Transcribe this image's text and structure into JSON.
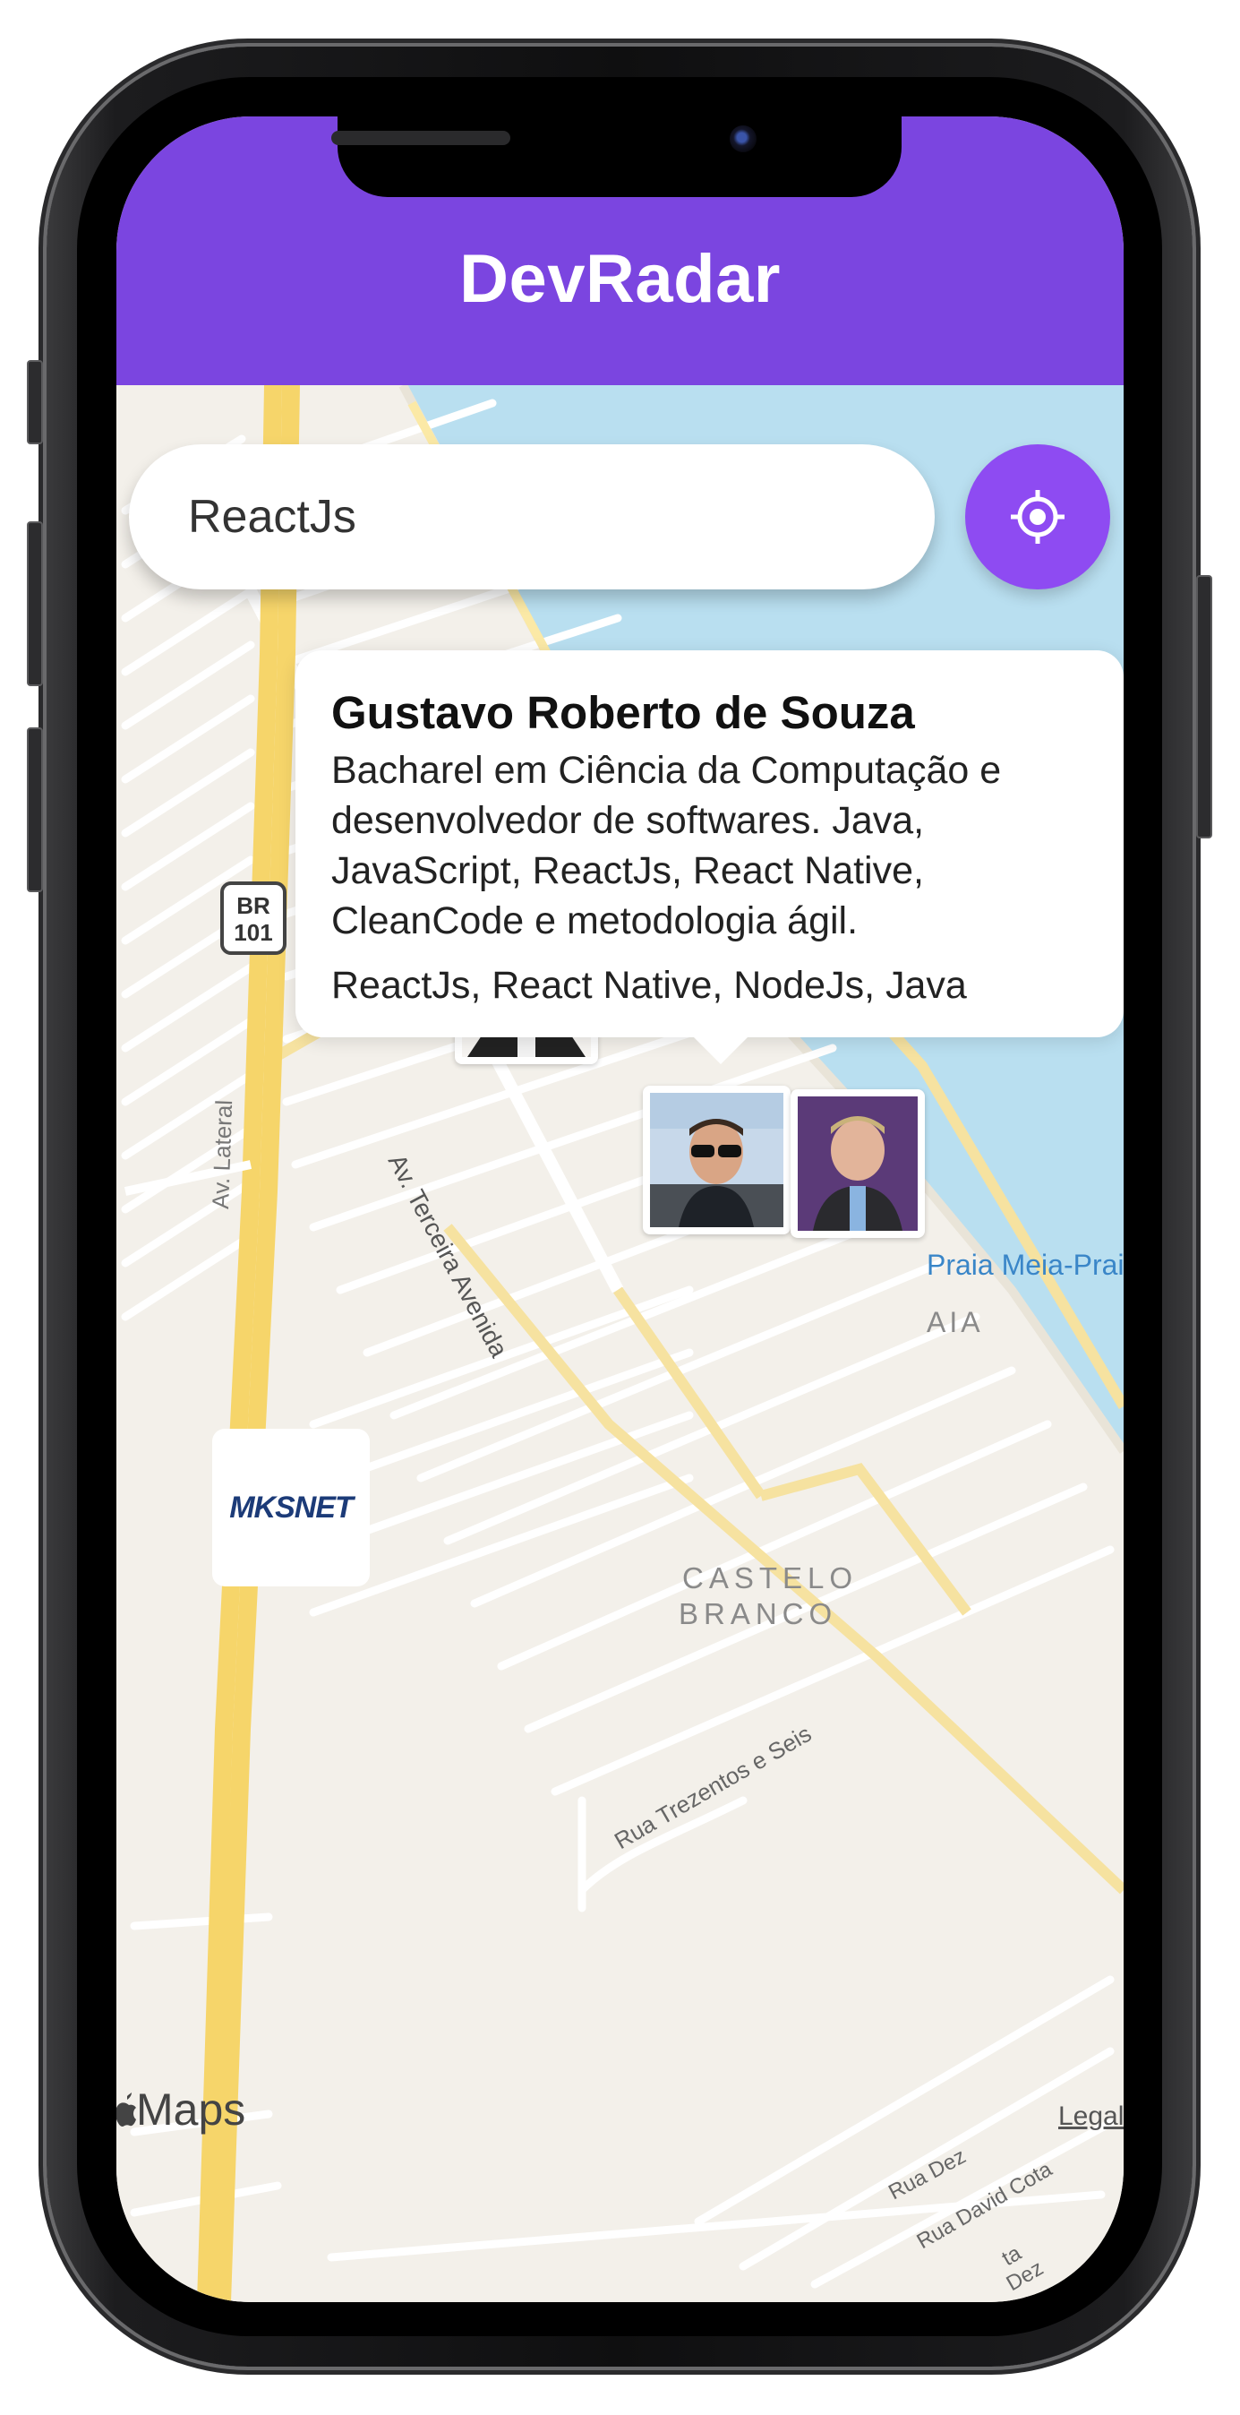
{
  "app": {
    "title": "DevRadar"
  },
  "search": {
    "value": "ReactJs"
  },
  "locate_button": {
    "icon": "crosshair-icon"
  },
  "callout": {
    "name": "Gustavo Roberto de Souza",
    "bio_lines": [
      "Bacharel em Ciência da Computação e",
      "desenvolvedor de softwares. Java,",
      "JavaScript, ReactJs, React Native,",
      "CleanCode e  metodologia ágil."
    ],
    "techs": "ReactJs, React Native, NodeJs, Java"
  },
  "map": {
    "labels": {
      "highway": "BR\n101",
      "av_lateral": "Av. Lateral",
      "av_terceira": "Av. Terceira Avenida",
      "praia": "Praia Meia-Praia",
      "praia_district": "AIA",
      "castelo_line1": "CASTELO",
      "castelo_line2": "BRANCO",
      "rua_trezentos": "Rua Trezentos e Seis",
      "rua_dez": "Rua Dez",
      "rua_david": "Rua David Cota",
      "rua_dez_bottom": "Dez",
      "rua_fragment": "ta"
    },
    "business_marker": "MKSNET",
    "attribution": "Maps",
    "legal": "Legal"
  },
  "colors": {
    "header": "#7b45e0",
    "locate_button": "#8e4bf2",
    "water": "#b9dff0",
    "land": "#f3f0ea",
    "road_major": "#f6d56a"
  }
}
